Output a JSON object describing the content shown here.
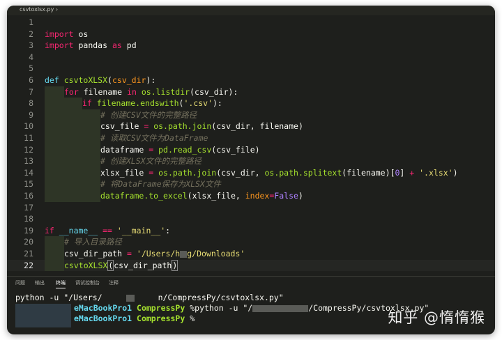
{
  "tab": {
    "filename": "csvtoxlsx.py"
  },
  "code_lines": [
    {
      "n": "1"
    },
    {
      "n": "2"
    },
    {
      "n": "3"
    },
    {
      "n": "4"
    },
    {
      "n": "5"
    },
    {
      "n": "6"
    },
    {
      "n": "7"
    },
    {
      "n": "8"
    },
    {
      "n": "9"
    },
    {
      "n": "10"
    },
    {
      "n": "11"
    },
    {
      "n": "12"
    },
    {
      "n": "13"
    },
    {
      "n": "14"
    },
    {
      "n": "15"
    },
    {
      "n": "16"
    },
    {
      "n": "17"
    },
    {
      "n": "18"
    },
    {
      "n": "19"
    },
    {
      "n": "20"
    },
    {
      "n": "21"
    },
    {
      "n": "22"
    }
  ],
  "tokens": {
    "import": "import",
    "os": "os",
    "pandas": "pandas",
    "as": "as",
    "pd": "pd",
    "def": "def",
    "func": "csvtoXLSX",
    "csv_dir": "csv_dir",
    "for": "for",
    "filename": "filename",
    "in": "in",
    "listdir": "os.listdir",
    "if": "if",
    "endswith": "filename.endswith",
    "csv_ext": "'.csv'",
    "comment1": "# 创建CSV文件的完整路径",
    "csv_file": "csv_file",
    "path_join": "os.path.join",
    "comment2": "# 读取CSV文件为DataFrame",
    "dataframe": "dataframe",
    "read_csv": "pd.read_csv",
    "comment3": "# 创建XLSX文件的完整路径",
    "xlsx_file": "xlsx_file",
    "splitext": "os.path.splitext",
    "zero": "0",
    "xlsx_ext": "'.xlsx'",
    "comment4": "# 将DataFrame保存为XLSX文件",
    "to_excel": "dataframe.to_excel",
    "index": "index",
    "false": "False",
    "name": "__name__",
    "main": "'__main__'",
    "comment5": "# 导入目录路径",
    "csv_dir_path": "csv_dir_path",
    "path_str_a": "'/Users/h",
    "path_str_b": "g/Downloads'",
    "call_func": "csvtoXLSX"
  },
  "panel_tabs": [
    {
      "label": "问题"
    },
    {
      "label": "输出"
    },
    {
      "label": "终端"
    },
    {
      "label": "调试控制台"
    },
    {
      "label": "注释"
    }
  ],
  "terminal": {
    "line1": "python -u \"/Users/",
    "line1_tail": "n/CompressPy/csvtoxlsx.py\"",
    "host": "eMacBookPro1",
    "dir": "CompressPy",
    "cmd2_a": "%python -u \"/",
    "cmd2_b": "/CompressPy/csvtoxlsx.py\"",
    "cmd3": "%"
  },
  "watermark": "知乎 @惰惰猴"
}
